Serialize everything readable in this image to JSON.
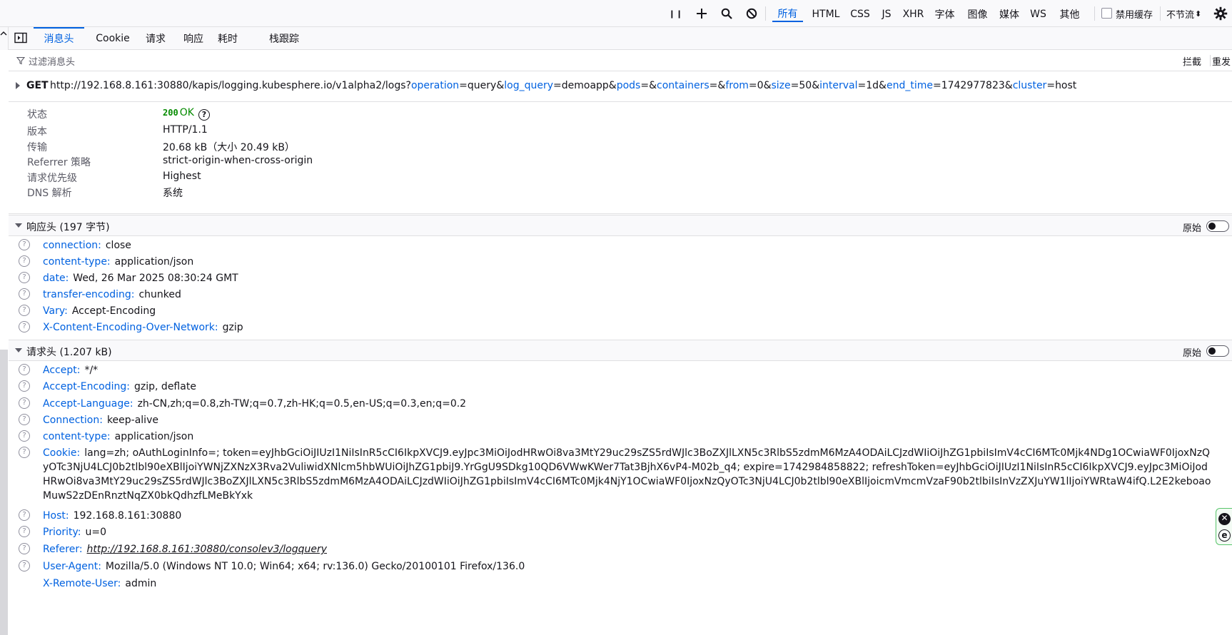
{
  "toolbar": {
    "pause_label": "❙❙",
    "filter_types": [
      "所有",
      "HTML",
      "CSS",
      "JS",
      "XHR",
      "字体",
      "图像",
      "媒体",
      "WS",
      "其他"
    ],
    "disable_cache_label": "禁用缓存",
    "throttle_label": "不节流",
    "throttle_arrow": "⬍"
  },
  "tabs": [
    "消息头",
    "Cookie",
    "请求",
    "响应",
    "耗时",
    "栈跟踪"
  ],
  "filter": {
    "placeholder": "过滤消息头",
    "block_label": "拦截",
    "resend_label": "重发"
  },
  "request": {
    "method": "GET",
    "url_base": "http://192.168.8.161:30880/kapis/logging.kubesphere.io/v1alpha2/logs?",
    "params": [
      {
        "key": "operation",
        "value": "query"
      },
      {
        "key": "log_query",
        "value": "demoapp"
      },
      {
        "key": "pods",
        "value": ""
      },
      {
        "key": "containers",
        "value": ""
      },
      {
        "key": "from",
        "value": "0"
      },
      {
        "key": "size",
        "value": "50"
      },
      {
        "key": "interval",
        "value": "1d"
      },
      {
        "key": "end_time",
        "value": "1742977823"
      },
      {
        "key": "cluster",
        "value": "host"
      }
    ]
  },
  "summary": [
    {
      "label": "状态",
      "value": "OK",
      "code": "200"
    },
    {
      "label": "版本",
      "value": "HTTP/1.1"
    },
    {
      "label": "传输",
      "value": "20.68 kB（大小 20.49 kB）"
    },
    {
      "label": "Referrer 策略",
      "value": "strict-origin-when-cross-origin"
    },
    {
      "label": "请求优先级",
      "value": "Highest"
    },
    {
      "label": "DNS 解析",
      "value": "系统"
    }
  ],
  "response_headers": {
    "title": "响应头 (197 字节)",
    "raw_label": "原始",
    "items": [
      {
        "name": "connection:",
        "value": "close"
      },
      {
        "name": "content-type:",
        "value": "application/json"
      },
      {
        "name": "date:",
        "value": "Wed, 26 Mar 2025 08:30:24 GMT"
      },
      {
        "name": "transfer-encoding:",
        "value": "chunked"
      },
      {
        "name": "Vary:",
        "value": "Accept-Encoding"
      },
      {
        "name": "X-Content-Encoding-Over-Network:",
        "value": "gzip"
      }
    ]
  },
  "request_headers": {
    "title": "请求头 (1.207 kB)",
    "raw_label": "原始",
    "items": [
      {
        "name": "Accept:",
        "value": "*/*"
      },
      {
        "name": "Accept-Encoding:",
        "value": "gzip, deflate"
      },
      {
        "name": "Accept-Language:",
        "value": "zh-CN,zh;q=0.8,zh-TW;q=0.7,zh-HK;q=0.5,en-US;q=0.3,en;q=0.2"
      },
      {
        "name": "Connection:",
        "value": "keep-alive"
      },
      {
        "name": "content-type:",
        "value": "application/json"
      },
      {
        "name": "Cookie:",
        "value": "lang=zh; oAuthLoginInfo=; token=eyJhbGciOiJIUzI1NiIsInR5cCI6IkpXVCJ9.eyJpc3MiOiJodHRwOi8va3MtY29uc29sZS5rdWJlc3BoZXJlLXN5c3RlbS5zdmM6MzA4ODAiLCJzdWIiOiJhZG1pbiIsImV4cCI6MTc0Mjk4NDg1OCwiaWF0IjoxNzQyOTc3NjU4LCJ0b2tlbl90eXBlIjoiYWNjZXNzX3Rva2VuliwidXNlcm5hbWUiOiJhZG1pbiJ9.YrGgU9SDkg10QD6VWwKWer7Tat3BjhX6vP4-M02b_q4; expire=1742984858822; refreshToken=eyJhbGciOiJIUzI1NiIsInR5cCI6IkpXVCJ9.eyJpc3MiOiJodHRwOi8va3MtY29uc29sZS5rdWJlc3BoZXJlLXN5c3RlbS5zdmM6MzA4ODAiLCJzdWIiOiJhZG1pbiIsImV4cCI6MTc0Mjk4NjY1OCwiaWF0IjoxNzQyOTc3NjU4LCJ0b2tlbl90eXBlIjoicmVmcmVzaF90b2tlbiIsInVzZXJuYW1lIjoiYWRtaW4ifQ.L2E2keboaoMuwS2zDEnRnztNqZX0bkQdhzfLMeBkYxk"
      },
      {
        "name": "Host:",
        "value": "192.168.8.161:30880"
      },
      {
        "name": "Priority:",
        "value": "u=0"
      },
      {
        "name": "Referer:",
        "value": "http://192.168.8.161:30880/consolev3/logquery",
        "link": true
      },
      {
        "name": "User-Agent:",
        "value": "Mozilla/5.0 (Windows NT 10.0; Win64; x64; rv:136.0) Gecko/20100101 Firefox/136.0"
      },
      {
        "name": "X-Remote-User:",
        "value": "admin",
        "noicon": true
      }
    ]
  },
  "colors": {
    "accent": "#0061e0",
    "status_ok": "#058b00",
    "widget_border": "#58c56b"
  }
}
